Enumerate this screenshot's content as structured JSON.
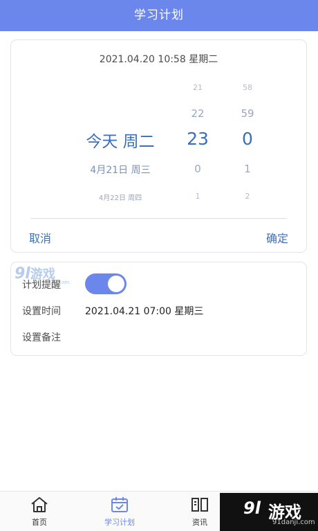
{
  "header": {
    "title": "学习计划"
  },
  "picker": {
    "current_datetime": "2021.04.20 10:58 星期二",
    "day_wheel": [
      "今天 周二",
      "4月21日 周三",
      "4月22日 周四"
    ],
    "hour_wheel": [
      "21",
      "22",
      "23",
      "0",
      "1"
    ],
    "minute_wheel": [
      "58",
      "59",
      "0",
      "1",
      "2"
    ],
    "cancel_label": "取消",
    "confirm_label": "确定"
  },
  "settings": {
    "remind_label": "计划提醒",
    "remind_enabled": true,
    "time_label": "设置时间",
    "time_value": "2021.04.21 07:00 星期三",
    "note_label": "设置备注"
  },
  "tabbar": {
    "items": [
      {
        "label": "首页",
        "icon": "home-icon"
      },
      {
        "label": "学习计划",
        "icon": "calendar-check-icon",
        "active": true
      },
      {
        "label": "资讯",
        "icon": "book-icon"
      }
    ]
  },
  "watermark": {
    "mark": "9l",
    "text": "游戏",
    "site_small": ".com",
    "site": "91danji.com"
  },
  "colors": {
    "accent": "#6b87ec",
    "picker_selected": "#3a6fb8",
    "link": "#3f71b5"
  }
}
